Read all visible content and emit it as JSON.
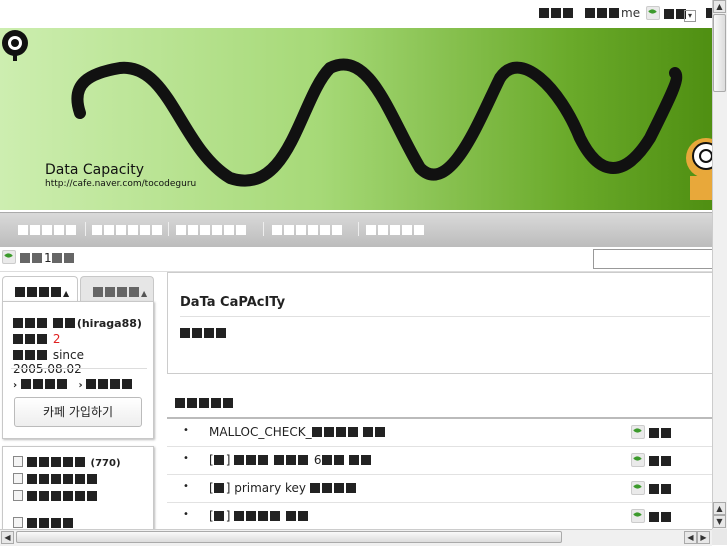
{
  "topbar": {
    "me_label": "me"
  },
  "banner": {
    "cafe_name": "Data Capacity",
    "cafe_url": "http://cafe.naver.com/tocodeguru"
  },
  "breadcrumb": {
    "page_number": "1"
  },
  "profile": {
    "user_id": "(hiraga88)",
    "count": "2",
    "since": "since 2005.08.02",
    "join_button": "카페 가입하기"
  },
  "menu": {
    "board_count": "(770)"
  },
  "cafe_info": {
    "title": "DaTa CaPAcITy"
  },
  "posts": [
    {
      "title": "MALLOC_CHECK_"
    },
    {
      "title_prefix": "[",
      "title_suffix": "]",
      "title_num": "6"
    },
    {
      "title_prefix": "[",
      "title_suffix": "]",
      "title_text": "primary key"
    },
    {
      "title_prefix": "[",
      "title_suffix": "]"
    }
  ],
  "colors": {
    "banner_start": "#cdeeb0",
    "banner_end": "#4f8f12",
    "count_red": "#e02020",
    "leaf_green": "#3c9a2c"
  }
}
